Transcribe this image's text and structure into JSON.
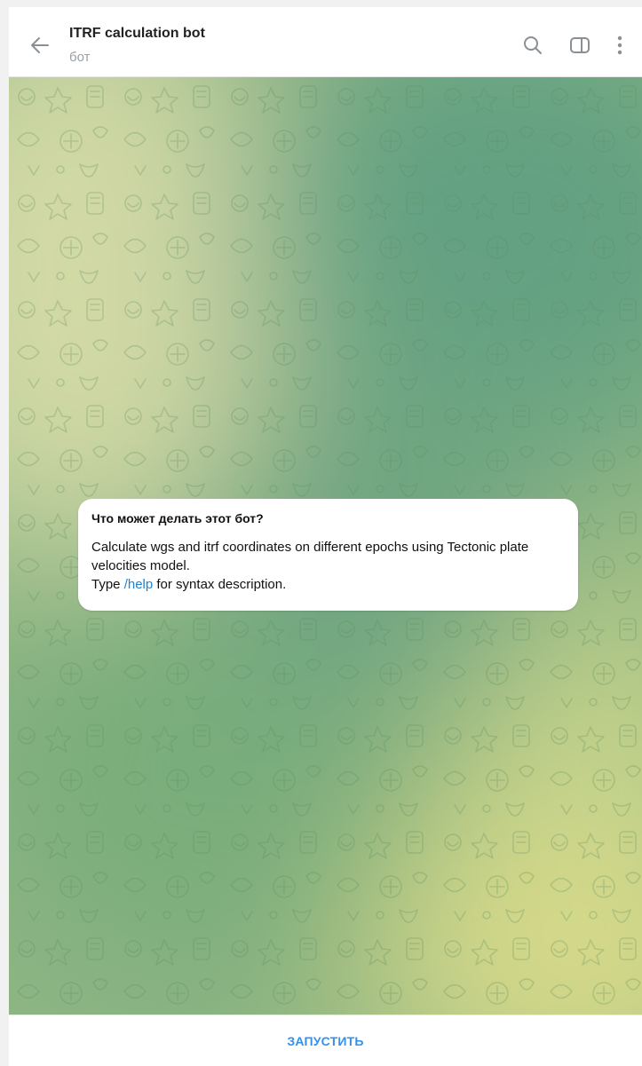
{
  "header": {
    "title": "ITRF calculation bot",
    "subtitle": "бот",
    "icons": [
      "back-arrow-icon",
      "search-icon",
      "sidebar-toggle-icon",
      "more-vertical-icon"
    ]
  },
  "bot_info": {
    "title": "Что может делать этот бот?",
    "line1": "Calculate wgs and itrf coordinates on different epochs using Tectonic plate velocities model.",
    "line2_prefix": "Type ",
    "line2_link": "/help",
    "line2_suffix": " for syntax description."
  },
  "bottom": {
    "start_label": "ЗАПУСТИТЬ"
  },
  "colors": {
    "accent": "#3390ec",
    "link": "#2481cc",
    "wallpaper_green": "#6fa584",
    "wallpaper_yellow": "#d4d98c"
  }
}
